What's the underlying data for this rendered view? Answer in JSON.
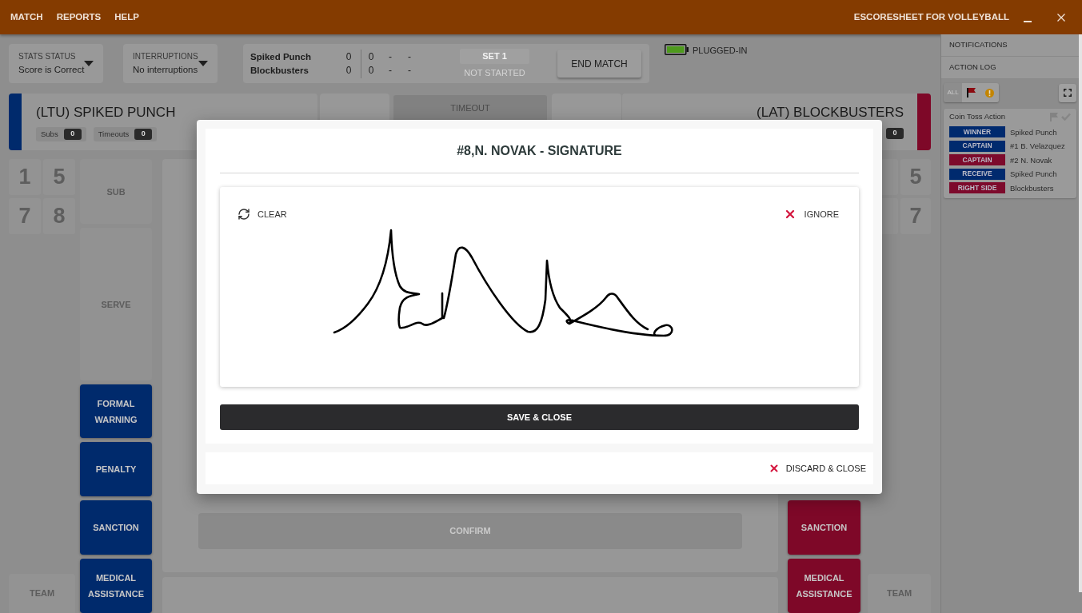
{
  "menu_bar": {
    "items": [
      "MATCH",
      "REPORTS",
      "HELP"
    ],
    "title": "ESCORESHEET FOR VOLLEYBALL"
  },
  "toolbar": {
    "dropdowns": [
      {
        "label": "STATS STATUS",
        "value": "Score is Correct"
      },
      {
        "label": "INTERRUPTIONS",
        "value": "No interruptions"
      }
    ],
    "scoreboard": {
      "rows": [
        {
          "team": "Spiked Punch",
          "sets_won": "0",
          "set_scores": [
            "0",
            "-",
            "-"
          ]
        },
        {
          "team": "Blockbusters",
          "sets_won": "0",
          "set_scores": [
            "0",
            "-",
            "-"
          ]
        }
      ],
      "set": {
        "label": "SET 1",
        "status": "NOT STARTED"
      },
      "end_match": "END MATCH"
    },
    "power": "PLUGGED-IN"
  },
  "teams": [
    {
      "name": "(LTU) SPIKED PUNCH",
      "color": "#002a6c",
      "counters": [
        {
          "label": "Subs",
          "value": "0"
        },
        {
          "label": "Timeouts",
          "value": "0"
        }
      ],
      "players": [
        "1",
        "5",
        "7",
        "8"
      ],
      "actions": [
        {
          "label": "SUB",
          "disabled": true
        },
        {
          "label": "SERVE",
          "disabled": true
        },
        {
          "label": "FORMAL WARNING",
          "disabled": false
        },
        {
          "label": "PENALTY",
          "disabled": false
        },
        {
          "label": "SANCTION",
          "disabled": false
        },
        {
          "label": "MEDICAL ASSISTANCE",
          "disabled": false
        }
      ],
      "team_button": "TEAM"
    },
    {
      "name": "(LAT) BLOCKBUSTERS",
      "color": "#7e0828",
      "counters": [
        {
          "value": "0"
        }
      ],
      "players": [
        "5",
        "7"
      ],
      "actions": [
        {
          "label": "SANCTION",
          "disabled": false
        },
        {
          "label": "MEDICAL ASSISTANCE",
          "disabled": false
        }
      ],
      "team_button": "TEAM"
    }
  ],
  "timeout": "TIMEOUT",
  "confirm": "CONFIRM",
  "modal": {
    "title": "#8,N. NOVAK - SIGNATURE",
    "clear": "CLEAR",
    "ignore": "IGNORE",
    "save": "SAVE & CLOSE",
    "discard": "DISCARD & CLOSE"
  },
  "sidebar": {
    "sections": [
      "NOTIFICATIONS",
      "ACTION LOG"
    ],
    "filters": [
      {
        "kind": "text",
        "label": "ALL",
        "selected": true
      },
      {
        "kind": "flag",
        "selected": false
      },
      {
        "kind": "warning",
        "selected": false
      }
    ],
    "log_card": {
      "title": "Coin Toss Action",
      "entries": [
        {
          "tag": "WINNER",
          "color": "#002a6e",
          "value": "Spiked Punch"
        },
        {
          "tag": "CAPTAIN",
          "color": "#002a6e",
          "value": "#1 B. Velazquez"
        },
        {
          "tag": "CAPTAIN",
          "color": "#7d0a2c",
          "value": "#2 N. Novak"
        },
        {
          "tag": "RECEIVE",
          "color": "#002a6e",
          "value": "Spiked Punch"
        },
        {
          "tag": "RIGHT SIDE",
          "color": "#7d0a2c",
          "value": "Blockbusters"
        }
      ]
    }
  }
}
